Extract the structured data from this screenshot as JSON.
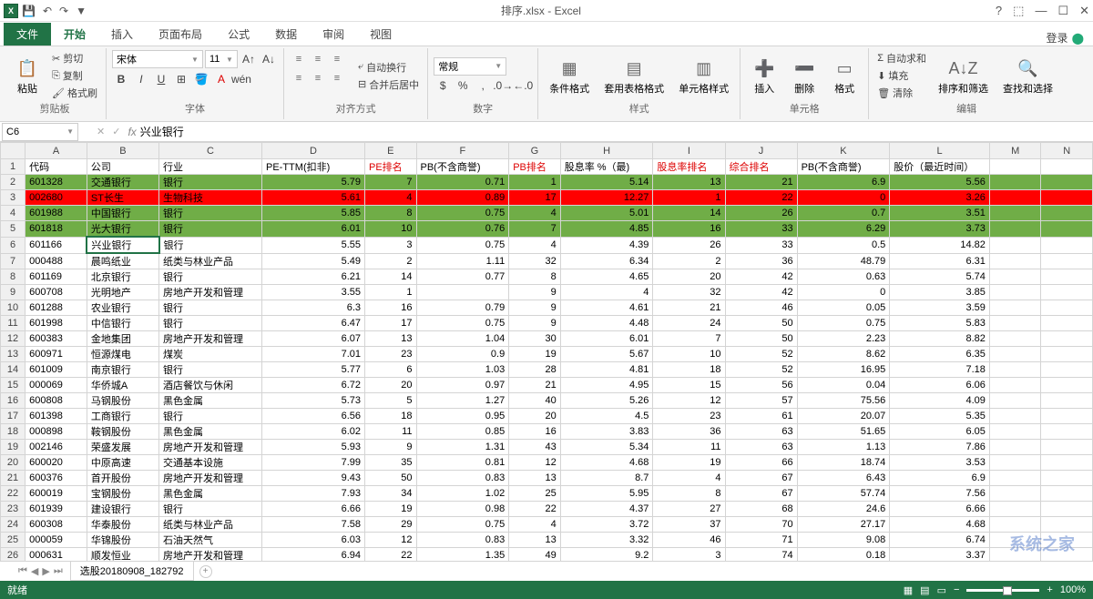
{
  "title": "排序.xlsx - Excel",
  "login": "登录",
  "tabs": [
    "文件",
    "开始",
    "插入",
    "页面布局",
    "公式",
    "数据",
    "审阅",
    "视图"
  ],
  "active_tab": "开始",
  "qat": {
    "save": "💾",
    "undo": "↶",
    "redo": "↷"
  },
  "ribbon": {
    "clipboard": {
      "name": "剪贴板",
      "paste": "粘贴",
      "cut": "剪切",
      "copy": "复制",
      "brush": "格式刷"
    },
    "font": {
      "name": "字体",
      "font_name": "宋体",
      "font_size": "11",
      "bold": "B",
      "italic": "I",
      "underline": "U"
    },
    "align": {
      "name": "对齐方式",
      "wrap": "自动换行",
      "merge": "合并后居中"
    },
    "number": {
      "name": "数字",
      "format": "常规"
    },
    "styles": {
      "name": "样式",
      "cond": "条件格式",
      "table": "套用表格格式",
      "cell": "单元格样式"
    },
    "cells": {
      "name": "单元格",
      "insert": "插入",
      "delete": "删除",
      "format": "格式"
    },
    "editing": {
      "name": "编辑",
      "sum": "自动求和",
      "fill": "填充",
      "clear": "清除",
      "sort": "排序和筛选",
      "find": "查找和选择"
    }
  },
  "name_box": "C6",
  "formula_value": "兴业银行",
  "columns": [
    "A",
    "B",
    "C",
    "D",
    "E",
    "F",
    "G",
    "H",
    "I",
    "J",
    "K",
    "L",
    "M",
    "N"
  ],
  "headers": {
    "A": "代码",
    "B": "公司",
    "C": "行业",
    "D": "PE-TTM(扣非)",
    "E": "PE排名",
    "F": "PB(不含商誉)",
    "G": "PB排名",
    "H": "股息率 %（最)",
    "I": "股息率排名",
    "J": "综合排名",
    "K": "PB(不含商誉)",
    "L": "股价（最近时间）"
  },
  "rows": [
    {
      "n": 2,
      "cls": "green",
      "d": [
        "601328",
        "交通银行",
        "银行",
        "5.79",
        "7",
        "0.71",
        "1",
        "5.14",
        "13",
        "21",
        "6.9",
        "5.56"
      ]
    },
    {
      "n": 3,
      "cls": "red-row",
      "d": [
        "002680",
        "ST长生",
        "生物科技",
        "5.61",
        "4",
        "0.89",
        "17",
        "12.27",
        "1",
        "22",
        "0",
        "3.26"
      ]
    },
    {
      "n": 4,
      "cls": "green",
      "d": [
        "601988",
        "中国银行",
        "银行",
        "5.85",
        "8",
        "0.75",
        "4",
        "5.01",
        "14",
        "26",
        "0.7",
        "3.51"
      ]
    },
    {
      "n": 5,
      "cls": "green",
      "d": [
        "601818",
        "光大银行",
        "银行",
        "6.01",
        "10",
        "0.76",
        "7",
        "4.85",
        "16",
        "33",
        "6.29",
        "3.73"
      ]
    },
    {
      "n": 6,
      "cls": "",
      "d": [
        "601166",
        "兴业银行",
        "银行",
        "5.55",
        "3",
        "0.75",
        "4",
        "4.39",
        "26",
        "33",
        "0.5",
        "14.82"
      ]
    },
    {
      "n": 7,
      "cls": "",
      "d": [
        "000488",
        "晨鸣纸业",
        "纸类与林业产品",
        "5.49",
        "2",
        "1.11",
        "32",
        "6.34",
        "2",
        "36",
        "48.79",
        "6.31"
      ]
    },
    {
      "n": 8,
      "cls": "",
      "d": [
        "601169",
        "北京银行",
        "银行",
        "6.21",
        "14",
        "0.77",
        "8",
        "4.65",
        "20",
        "42",
        "0.63",
        "5.74"
      ]
    },
    {
      "n": 9,
      "cls": "",
      "d": [
        "600708",
        "光明地产",
        "房地产开发和管理",
        "3.55",
        "1",
        "",
        "9",
        "4",
        "32",
        "42",
        "0",
        "3.85"
      ]
    },
    {
      "n": 10,
      "cls": "",
      "d": [
        "601288",
        "农业银行",
        "银行",
        "6.3",
        "16",
        "0.79",
        "9",
        "4.61",
        "21",
        "46",
        "0.05",
        "3.59"
      ]
    },
    {
      "n": 11,
      "cls": "",
      "d": [
        "601998",
        "中信银行",
        "银行",
        "6.47",
        "17",
        "0.75",
        "9",
        "4.48",
        "24",
        "50",
        "0.75",
        "5.83"
      ]
    },
    {
      "n": 12,
      "cls": "",
      "d": [
        "600383",
        "金地集团",
        "房地产开发和管理",
        "6.07",
        "13",
        "1.04",
        "30",
        "6.01",
        "7",
        "50",
        "2.23",
        "8.82"
      ]
    },
    {
      "n": 13,
      "cls": "",
      "d": [
        "600971",
        "恒源煤电",
        "煤炭",
        "7.01",
        "23",
        "0.9",
        "19",
        "5.67",
        "10",
        "52",
        "8.62",
        "6.35"
      ]
    },
    {
      "n": 14,
      "cls": "",
      "d": [
        "601009",
        "南京银行",
        "银行",
        "5.77",
        "6",
        "1.03",
        "28",
        "4.81",
        "18",
        "52",
        "16.95",
        "7.18"
      ]
    },
    {
      "n": 15,
      "cls": "",
      "d": [
        "000069",
        "华侨城A",
        "酒店餐饮与休闲",
        "6.72",
        "20",
        "0.97",
        "21",
        "4.95",
        "15",
        "56",
        "0.04",
        "6.06"
      ]
    },
    {
      "n": 16,
      "cls": "",
      "d": [
        "600808",
        "马钢股份",
        "黑色金属",
        "5.73",
        "5",
        "1.27",
        "40",
        "5.26",
        "12",
        "57",
        "75.56",
        "4.09"
      ]
    },
    {
      "n": 17,
      "cls": "",
      "d": [
        "601398",
        "工商银行",
        "银行",
        "6.56",
        "18",
        "0.95",
        "20",
        "4.5",
        "23",
        "61",
        "20.07",
        "5.35"
      ]
    },
    {
      "n": 18,
      "cls": "",
      "d": [
        "000898",
        "鞍钢股份",
        "黑色金属",
        "6.02",
        "11",
        "0.85",
        "16",
        "3.83",
        "36",
        "63",
        "51.65",
        "6.05"
      ]
    },
    {
      "n": 19,
      "cls": "",
      "d": [
        "002146",
        "荣盛发展",
        "房地产开发和管理",
        "5.93",
        "9",
        "1.31",
        "43",
        "5.34",
        "11",
        "63",
        "1.13",
        "7.86"
      ]
    },
    {
      "n": 20,
      "cls": "",
      "d": [
        "600020",
        "中原高速",
        "交通基本设施",
        "7.99",
        "35",
        "0.81",
        "12",
        "4.68",
        "19",
        "66",
        "18.74",
        "3.53"
      ]
    },
    {
      "n": 21,
      "cls": "",
      "d": [
        "600376",
        "首开股份",
        "房地产开发和管理",
        "9.43",
        "50",
        "0.83",
        "13",
        "8.7",
        "4",
        "67",
        "6.43",
        "6.9"
      ]
    },
    {
      "n": 22,
      "cls": "",
      "d": [
        "600019",
        "宝钢股份",
        "黑色金属",
        "7.93",
        "34",
        "1.02",
        "25",
        "5.95",
        "8",
        "67",
        "57.74",
        "7.56"
      ]
    },
    {
      "n": 23,
      "cls": "",
      "d": [
        "601939",
        "建设银行",
        "银行",
        "6.66",
        "19",
        "0.98",
        "22",
        "4.37",
        "27",
        "68",
        "24.6",
        "6.66"
      ]
    },
    {
      "n": 24,
      "cls": "",
      "d": [
        "600308",
        "华泰股份",
        "纸类与林业产品",
        "7.58",
        "29",
        "0.75",
        "4",
        "3.72",
        "37",
        "70",
        "27.17",
        "4.68"
      ]
    },
    {
      "n": 25,
      "cls": "",
      "d": [
        "000059",
        "华锦股份",
        "石油天然气",
        "6.03",
        "12",
        "0.83",
        "13",
        "3.32",
        "46",
        "71",
        "9.08",
        "6.74"
      ]
    },
    {
      "n": 26,
      "cls": "",
      "d": [
        "000631",
        "顺发恒业",
        "房地产开发和管理",
        "6.94",
        "22",
        "1.35",
        "49",
        "9.2",
        "3",
        "74",
        "0.18",
        "3.37"
      ]
    }
  ],
  "sheet_tab": "选股20180908_182792",
  "status": "就绪",
  "zoom": "100%",
  "watermark": "系统之家"
}
